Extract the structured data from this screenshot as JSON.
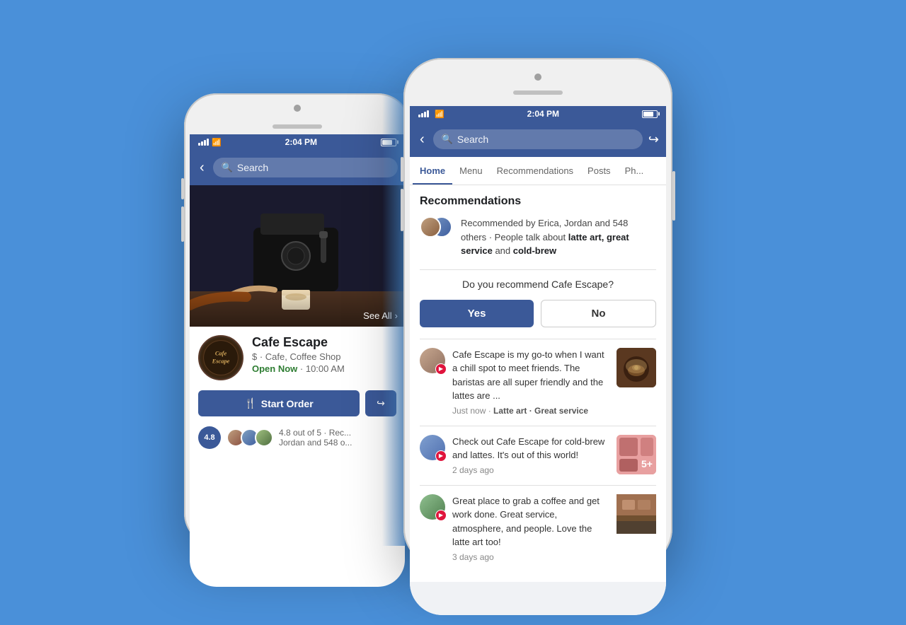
{
  "background_color": "#4a90d9",
  "status_bar": {
    "time": "2:04 PM",
    "battery_label": "Battery"
  },
  "nav": {
    "search_placeholder": "Search",
    "back_icon": "‹",
    "share_icon": "↪"
  },
  "tabs": {
    "items": [
      {
        "label": "Home",
        "active": true
      },
      {
        "label": "Menu",
        "active": false
      },
      {
        "label": "Recommendations",
        "active": false
      },
      {
        "label": "Posts",
        "active": false
      },
      {
        "label": "Ph...",
        "active": false
      }
    ]
  },
  "recommendations": {
    "section_title": "Recommendations",
    "rec_text": "Recommended by Erica, Jordan and 548 others · People talk about ",
    "bold_1": "latte art,",
    "bold_2": "great service",
    "text_and": " and ",
    "bold_3": "cold-brew",
    "question": "Do you recommend Cafe Escape?",
    "yes_label": "Yes",
    "no_label": "No"
  },
  "reviews": [
    {
      "text": "Cafe Escape is my go-to when I want a chill spot to meet friends. The baristas are all super friendly and the lattes are ...",
      "time": "Just now",
      "tags": "Latte art · Great service",
      "thumb_type": "latte"
    },
    {
      "text": "Check out Cafe Escape for cold-brew and lattes. It's out of this world!",
      "time": "2 days ago",
      "tags": "",
      "thumb_type": "multi"
    },
    {
      "text": "Great place to grab a coffee and get work done. Great service, atmosphere, and people. Love the latte art too!",
      "time": "3 days ago",
      "tags": "",
      "thumb_type": "cafe"
    }
  ],
  "business": {
    "name": "Cafe Escape",
    "category": "$ · Cafe, Coffee Shop",
    "status_open": "Open Now",
    "status_hours": " · 10:00 AM",
    "start_order_label": "Start Order",
    "rating": "4.8",
    "rating_text": "4.8 out of 5 · Rec...",
    "rec_names": "Jordan and 548 o...",
    "logo_text": "Cafe\nEscape"
  },
  "see_all": "See All"
}
